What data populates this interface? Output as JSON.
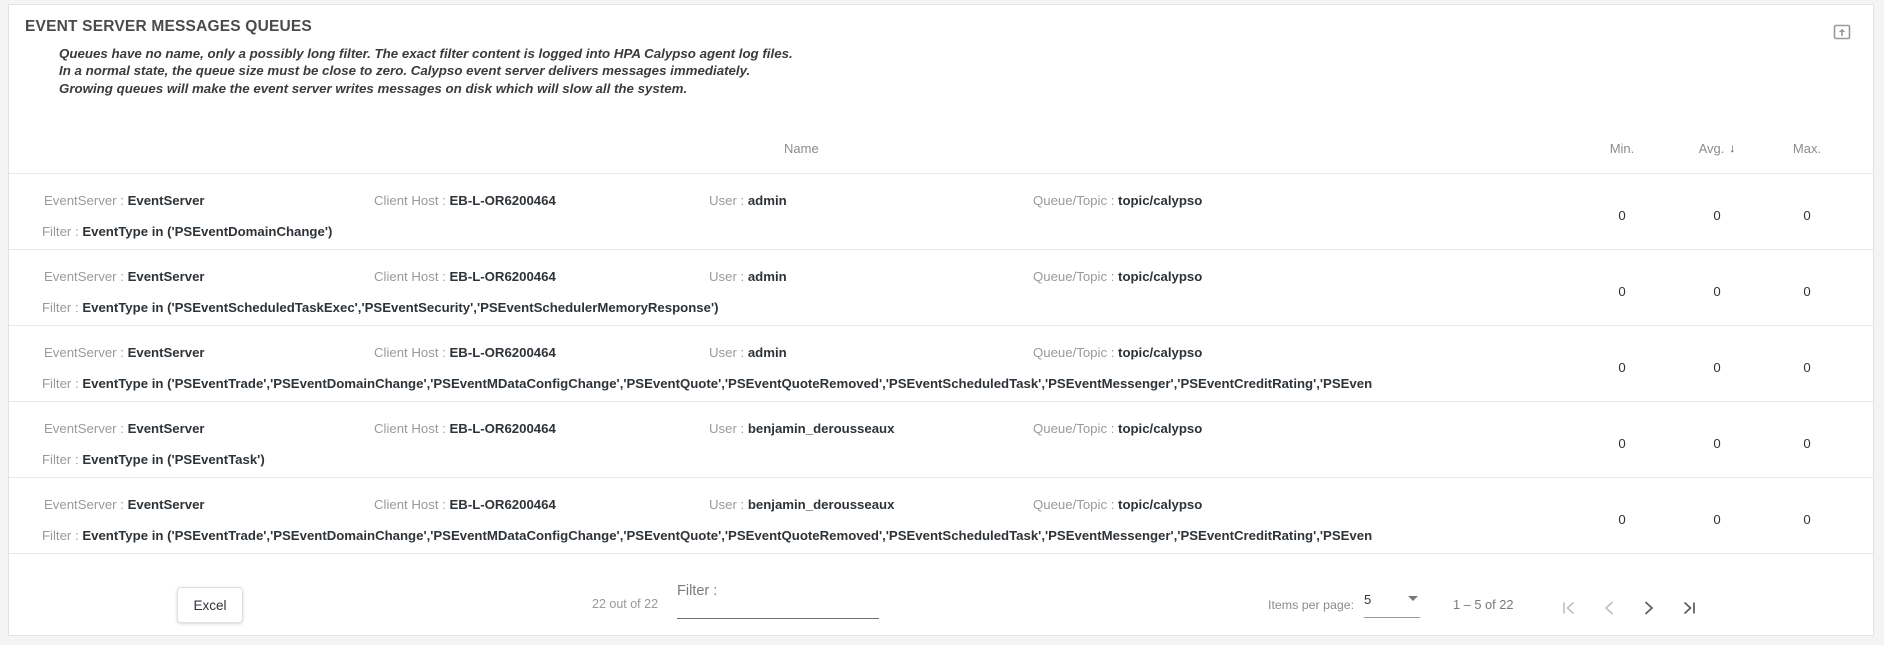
{
  "card": {
    "title": "EVENT SERVER MESSAGES QUEUES",
    "export_icon": "open-in-new-icon",
    "description_lines": [
      "Queues have no name, only a possibly long filter. The exact filter content is logged into HPA Calypso agent log files.",
      "In a normal state, the queue size must be close to zero. Calypso event server delivers messages immediately.",
      "Growing queues will make the event server writes messages on disk which will slow all the system."
    ]
  },
  "table": {
    "headers": {
      "name": "Name",
      "min": "Min.",
      "avg": "Avg.",
      "max": "Max.",
      "sort_arrow": "↓",
      "sorted_by": "Avg.",
      "sort_direction": "desc"
    },
    "labels": {
      "server": "EventServer :",
      "host": "Client Host :",
      "user": "User :",
      "queue": "Queue/Topic :",
      "filter": "Filter :"
    },
    "rows": [
      {
        "server": "EventServer",
        "host": "EB-L-OR6200464",
        "user": "admin",
        "queue": "topic/calypso",
        "filter": "EventType in ('PSEventDomainChange')",
        "min": "0",
        "avg": "0",
        "max": "0"
      },
      {
        "server": "EventServer",
        "host": "EB-L-OR6200464",
        "user": "admin",
        "queue": "topic/calypso",
        "filter": "EventType in ('PSEventScheduledTaskExec','PSEventSecurity','PSEventSchedulerMemoryResponse')",
        "min": "0",
        "avg": "0",
        "max": "0"
      },
      {
        "server": "EventServer",
        "host": "EB-L-OR6200464",
        "user": "admin",
        "queue": "topic/calypso",
        "filter": "EventType in ('PSEventTrade','PSEventDomainChange','PSEventMDataConfigChange','PSEventQuote','PSEventQuoteRemoved','PSEventScheduledTask','PSEventMessenger','PSEventCreditRating','PSEventProductCreditRating','PSEve",
        "min": "0",
        "avg": "0",
        "max": "0"
      },
      {
        "server": "EventServer",
        "host": "EB-L-OR6200464",
        "user": "benjamin_derousseaux",
        "queue": "topic/calypso",
        "filter": "EventType in ('PSEventTask')",
        "min": "0",
        "avg": "0",
        "max": "0"
      },
      {
        "server": "EventServer",
        "host": "EB-L-OR6200464",
        "user": "benjamin_derousseaux",
        "queue": "topic/calypso",
        "filter": "EventType in ('PSEventTrade','PSEventDomainChange','PSEventMDataConfigChange','PSEventQuote','PSEventQuoteRemoved','PSEventScheduledTask','PSEventMessenger','PSEventCreditRating','PSEventProductCreditRating','PSEve",
        "min": "0",
        "avg": "0",
        "max": "0"
      }
    ]
  },
  "footer": {
    "excel_label": "Excel",
    "out_of_label": "22 out of 22",
    "filter_label": "Filter :",
    "filter_value": "",
    "filter_placeholder": "",
    "items_per_page_label": "Items per page:",
    "items_per_page_value": "5",
    "range_label": "1 – 5 of 22",
    "pager": {
      "first_icon": "first-page-icon",
      "prev_icon": "previous-page-icon",
      "next_icon": "next-page-icon",
      "last_icon": "last-page-icon",
      "first_enabled": false,
      "prev_enabled": false,
      "next_enabled": true,
      "last_enabled": true
    }
  },
  "colors": {
    "title": "#4a4a4a",
    "label": "#9a9a9a",
    "value": "#2e3338",
    "border": "#e8e8e8"
  }
}
